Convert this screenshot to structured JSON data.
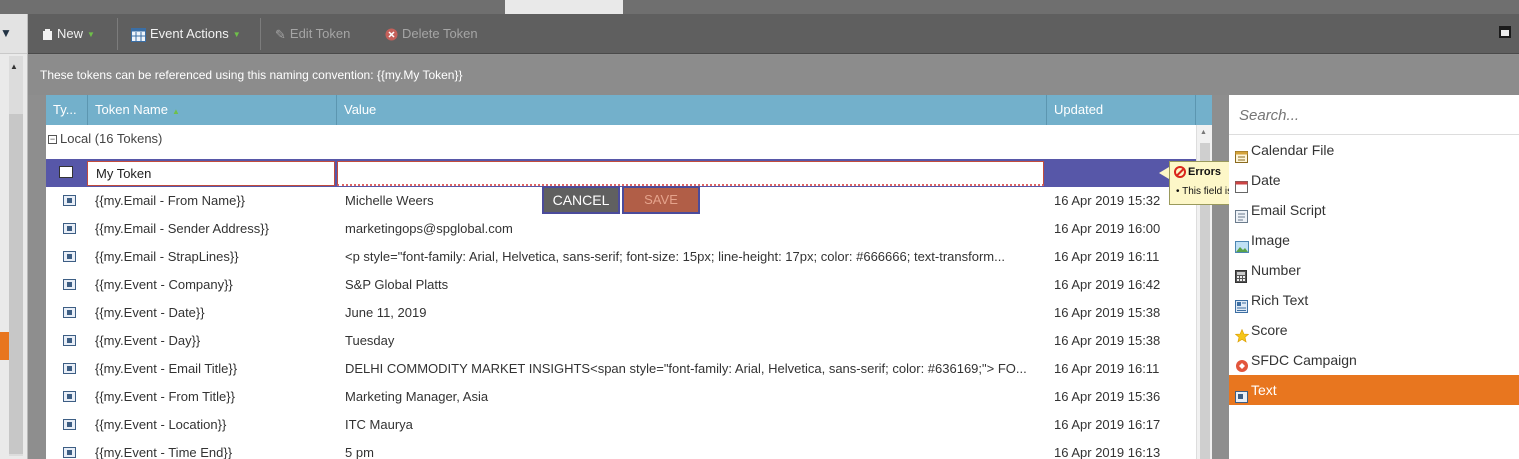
{
  "toolbar": {
    "new_label": "New",
    "event_actions_label": "Event Actions",
    "edit_token_label": "Edit Token",
    "delete_token_label": "Delete Token"
  },
  "info": {
    "naming_text": "These tokens can be referenced using this naming convention: {{my.My Token}}"
  },
  "grid": {
    "columns": [
      "Ty...",
      "Token Name",
      "Value",
      "Updated"
    ],
    "group_label": "Local (16 Tokens)",
    "edit_row": {
      "name_value": "My Token",
      "value_value": ""
    },
    "rows": [
      {
        "name": "{{my.Email - From Name}}",
        "value": "Michelle Weers",
        "updated": "16 Apr 2019 15:32"
      },
      {
        "name": "{{my.Email - Sender Address}}",
        "value": "marketingops@spglobal.com",
        "updated": "16 Apr 2019 16:00"
      },
      {
        "name": "{{my.Email - StrapLines}}",
        "value": "<p style=\"font-family: Arial, Helvetica, sans-serif; font-size: 15px; line-height: 17px; color: #666666; text-transform...",
        "updated": "16 Apr 2019 16:11"
      },
      {
        "name": "{{my.Event - Company}}",
        "value": "S&P Global Platts",
        "updated": "16 Apr 2019 16:42"
      },
      {
        "name": "{{my.Event - Date}}",
        "value": "June 11, 2019",
        "updated": "16 Apr 2019 15:38"
      },
      {
        "name": "{{my.Event - Day}}",
        "value": "Tuesday",
        "updated": "16 Apr 2019 15:38"
      },
      {
        "name": "{{my.Event - Email Title}}",
        "value": "DELHI COMMODITY MARKET INSIGHTS<span style=\"font-family: Arial, Helvetica, sans-serif; color: #636169;\"> FO...",
        "updated": "16 Apr 2019 16:11"
      },
      {
        "name": "{{my.Event - From Title}}",
        "value": "Marketing Manager, Asia",
        "updated": "16 Apr 2019 15:36"
      },
      {
        "name": "{{my.Event - Location}}",
        "value": "ITC Maurya",
        "updated": "16 Apr 2019 16:17"
      },
      {
        "name": "{{my.Event - Time End}}",
        "value": "5 pm",
        "updated": "16 Apr 2019 16:13"
      }
    ],
    "cancel_label": "CANCEL",
    "save_label": "SAVE"
  },
  "error_tooltip": {
    "title": "Errors",
    "message": "This field is required"
  },
  "type_panel": {
    "search_placeholder": "Search...",
    "items": [
      {
        "label": "Calendar File",
        "icon": "calendar-icon",
        "selected": false
      },
      {
        "label": "Date",
        "icon": "date-icon",
        "selected": false
      },
      {
        "label": "Email Script",
        "icon": "email-script-icon",
        "selected": false
      },
      {
        "label": "Image",
        "icon": "image-icon",
        "selected": false
      },
      {
        "label": "Number",
        "icon": "number-icon",
        "selected": false
      },
      {
        "label": "Rich Text",
        "icon": "rich-text-icon",
        "selected": false
      },
      {
        "label": "Score",
        "icon": "star-icon",
        "selected": false
      },
      {
        "label": "SFDC Campaign",
        "icon": "sfdc-campaign-icon",
        "selected": false
      },
      {
        "label": "Text",
        "icon": "text-icon",
        "selected": true
      }
    ]
  },
  "colors": {
    "header_blue": "#73b0cb",
    "edit_row_purple": "#5757a8",
    "selected_orange": "#e8761f",
    "toolbar_gray": "#5f5f5f"
  }
}
